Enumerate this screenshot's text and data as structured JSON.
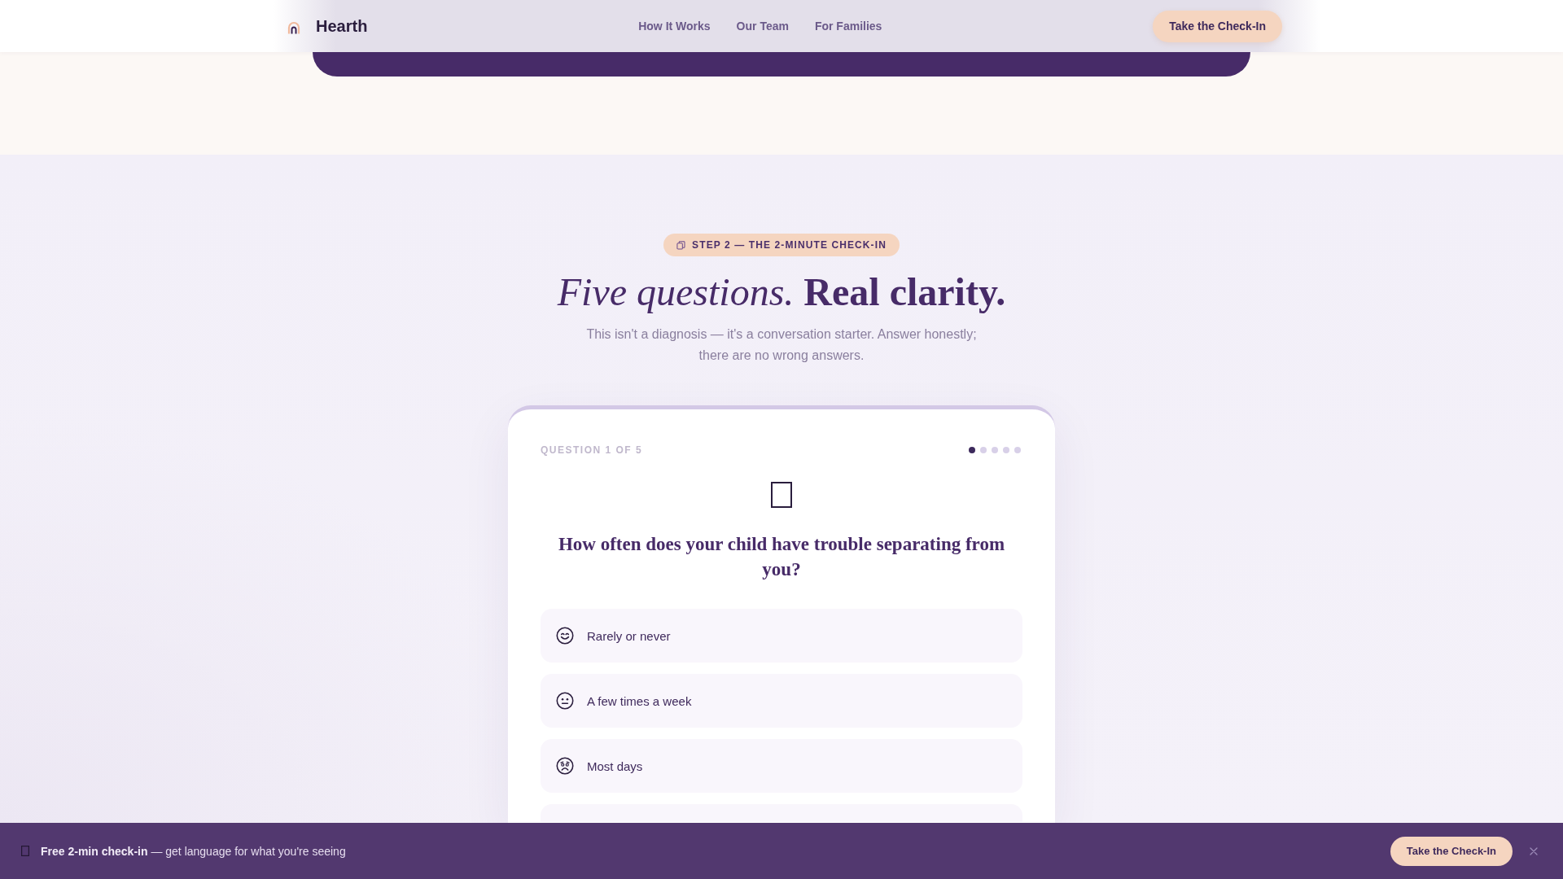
{
  "header": {
    "brand": "Hearth",
    "nav": [
      {
        "label": "How It Works"
      },
      {
        "label": "Our Team"
      },
      {
        "label": "For Families"
      }
    ],
    "cta": "Take the Check-In"
  },
  "checkin": {
    "badge": "STEP 2 — THE 2-MINUTE CHECK-IN",
    "title": "*Five questions.* **Real clarity.**",
    "subtitle": "This isn't a diagnosis — it's a conversation starter. Answer honestly; there are no wrong answers.",
    "card": {
      "counter": "QUESTION 1 OF 5",
      "dots": [
        {
          "active": true
        },
        {
          "active": false
        },
        {
          "active": false
        },
        {
          "active": false
        },
        {
          "active": false
        }
      ],
      "question": "How often does your child have trouble separating from you?",
      "options": [
        {
          "label": "Rarely or never",
          "selected": false
        },
        {
          "label": "A few times a week",
          "selected": false
        },
        {
          "label": "Most days",
          "selected": false
        },
        {
          "selected": false
        }
      ]
    }
  },
  "sticky_bar": {
    "text": "**Free 2-min check-in** — get language for what you're seeing",
    "cta": "Take the Check-In"
  }
}
